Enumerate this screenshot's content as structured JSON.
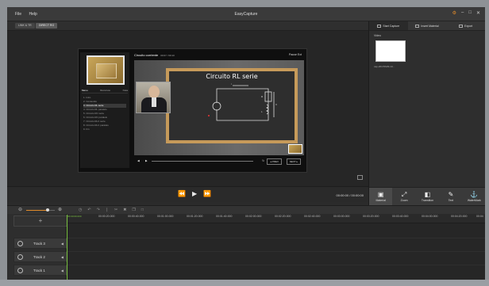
{
  "app": {
    "title": "EasyCapture",
    "menu": [
      "File",
      "Help"
    ],
    "window_controls": [
      "⚙",
      "–",
      "□",
      "✕"
    ]
  },
  "subbar": {
    "tab_a": "LINK & TR",
    "tab_b": "DIRECT RG"
  },
  "slide": {
    "header": "Circuito corriente",
    "header_sub": "00:07 / 00:10",
    "controls": "Pause  Ext",
    "board_title": "Circuito RL serie",
    "tabs": [
      "Menu",
      "Recursos",
      "Nota"
    ],
    "outline": [
      "1. Intro",
      "2. Contenido",
      "3. Circuito RL serie",
      "4. Circuito RL paralelo",
      "5. Circuito RC serie",
      "6. Circuito RC paralelo",
      "7. Circuito RLC serie",
      "8. Circuito RLC paralelo",
      "9. Fin"
    ],
    "prev": "◂ PREV",
    "next": "NEXT ▸"
  },
  "transport": {
    "timecode": "00:00:00 / 00:00:00"
  },
  "right_panel": {
    "tabs": [
      "Start Capture",
      "Insert Material",
      "Export"
    ],
    "video_label": "Video",
    "video_name": "cap-20170629-10..."
  },
  "tools": [
    {
      "icon": "▣",
      "label": "Material"
    },
    {
      "icon": "⤢",
      "label": "Zoom"
    },
    {
      "icon": "◧",
      "label": "Transition"
    },
    {
      "icon": "✎",
      "label": "Text"
    },
    {
      "icon": "⚓",
      "label": "WaterMark"
    }
  ],
  "timeline": {
    "playhead": "00:00:00.000",
    "zoom_level": 0.75,
    "ticks": [
      "00:00:20.000",
      "00:00:40.000",
      "00:01:00.000",
      "00:01:20.000",
      "00:01:40.000",
      "00:02:00.000",
      "00:02:20.000",
      "00:02:40.000",
      "00:03:00.000",
      "00:03:20.000",
      "00:03:40.000",
      "00:04:00.000",
      "00:04:20.000",
      "00:04"
    ],
    "tracks": [
      "Track 3",
      "Track 2",
      "Track 1"
    ]
  }
}
